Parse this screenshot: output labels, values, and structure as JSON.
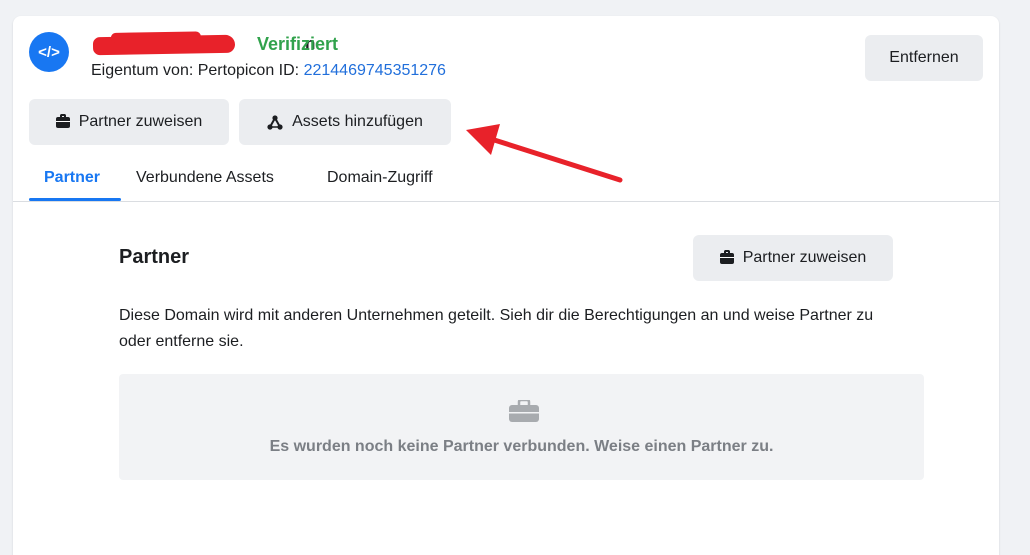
{
  "header": {
    "avatar_glyph": "</>",
    "domain_name_visible_tail": "n",
    "verified_label": "Verifiziert",
    "owner_label": "Eigentum von: Pertopicon",
    "id_label": "ID:",
    "id_value": "2214469745351276",
    "remove_button_label": "Entfernen",
    "assign_partner_button_label": "Partner zuweisen",
    "add_assets_button_label": "Assets hinzufügen"
  },
  "tabs": [
    {
      "label": "Partner",
      "active": true
    },
    {
      "label": "Verbundene Assets",
      "active": false
    },
    {
      "label": "Domain-Zugriff",
      "active": false
    }
  ],
  "partner_section": {
    "title": "Partner",
    "assign_button_label": "Partner zuweisen",
    "description": "Diese Domain wird mit anderen Unternehmen geteilt. Sieh dir die Berechtigungen an und weise Partner zu oder entferne sie.",
    "empty_state_text": "Es wurden noch keine Partner verbunden. Weise einen Partner zu."
  },
  "colors": {
    "accent": "#1877f2",
    "verified": "#31a24c",
    "id_link": "#216fdb",
    "annotation_arrow": "#e8222a",
    "button_bg": "#ebedf0"
  },
  "icons": {
    "avatar": "code-brackets-icon",
    "assign_partner": "briefcase-icon",
    "add_assets": "network-nodes-icon",
    "empty_state": "briefcase-icon"
  }
}
